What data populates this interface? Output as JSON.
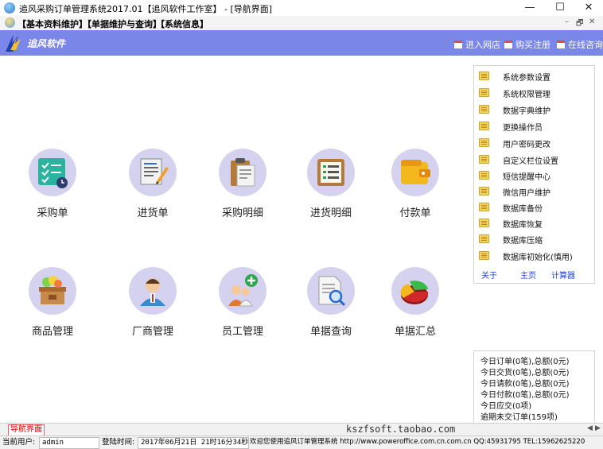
{
  "window": {
    "title": "追风采购订单管理系统2017.01【追风软件工作室】 - [导航界面]",
    "controls": [
      "—",
      "☐",
      "✕"
    ]
  },
  "menu": {
    "items": [
      "【基本资料维护】",
      "【单据维护与查询】",
      "【系统信息】"
    ],
    "mdi_controls": [
      "–",
      "🗗",
      "✕"
    ]
  },
  "header": {
    "brand": "追风软件",
    "links": [
      "进入网店",
      "购买注册",
      "在线咨询"
    ]
  },
  "modules": [
    {
      "label": "采购单",
      "icon": "checklist-icon"
    },
    {
      "label": "进货单",
      "icon": "notepad-pencil-icon"
    },
    {
      "label": "采购明细",
      "icon": "clipboard-icon"
    },
    {
      "label": "进货明细",
      "icon": "list-board-icon"
    },
    {
      "label": "付款单",
      "icon": "wallet-icon"
    },
    {
      "label": "商品管理",
      "icon": "goods-box-icon"
    },
    {
      "label": "厂商管理",
      "icon": "vendor-person-icon"
    },
    {
      "label": "员工管理",
      "icon": "staff-add-icon"
    },
    {
      "label": "单据查询",
      "icon": "document-search-icon"
    },
    {
      "label": "单据汇总",
      "icon": "pie-chart-icon"
    }
  ],
  "side_panel": {
    "items": [
      "系统参数设置",
      "系统权限管理",
      "数据字典维护",
      "更换操作员",
      "用户密码更改",
      "自定义栏位设置",
      "短信提醒中心",
      "微信用户维护",
      "数据库备份",
      "数据库恢复",
      "数据库压缩",
      "数据库初始化(慎用)"
    ],
    "links": [
      "关于",
      "主页",
      "计算器"
    ]
  },
  "stats": {
    "rows": [
      "今日订单(0笔),总额(0元)",
      "今日交货(0笔),总额(0元)",
      "今日请款(0笔),总额(0元)",
      "今日付款(0笔),总额(0元)",
      "今日应交(0项)",
      "逾期未交订单(159项)"
    ]
  },
  "tabs": {
    "active": "导航界面",
    "watermark": "kszfsoft.taobao.com"
  },
  "status": {
    "user_label": "当前用户:",
    "user": "admin",
    "login_label": "登陆时间:",
    "login_time": "2017年06月21日 21时16分34秒",
    "welcome": "欢迎您使用追风订单管理系统 http://www.poweroffice.com.cn.com.cn QQ:45931795 TEL:15962625220"
  },
  "colors": {
    "header_bg": "#7a86e8",
    "circle_bg": "#d4d2ee",
    "panel_link": "#1a3fcf",
    "active_tab": "#d10000"
  }
}
